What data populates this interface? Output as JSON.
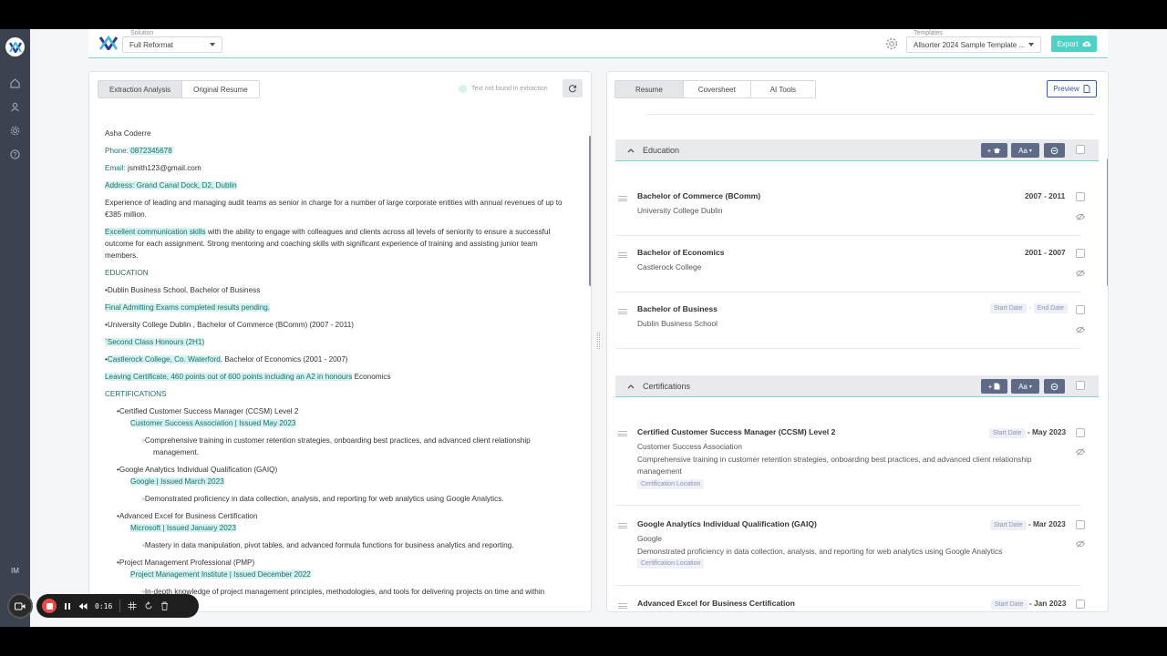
{
  "sidebar": {
    "user_initials": "IM"
  },
  "header": {
    "solution_label": "Solution",
    "solution_value": "Full Reformat",
    "templates_label": "Templates",
    "templates_value": "Allsorter 2024 Sample Template ...",
    "export_label": "Export"
  },
  "left_panel": {
    "tabs": [
      "Extraction Analysis",
      "Original Resume"
    ],
    "legend_text": "Text not found in extraction",
    "resume_lines": [
      {
        "segments": [
          {
            "t": "Asha Coderre",
            "h": 0
          }
        ]
      },
      {
        "segments": [
          {
            "t": "Phone:",
            "h": 2
          },
          {
            "t": " 0872345678",
            "h": 1
          }
        ]
      },
      {
        "segments": [
          {
            "t": "Email:",
            "h": 2
          },
          {
            "t": " jsmith123@gmail.com",
            "h": 0
          }
        ]
      },
      {
        "segments": [
          {
            "t": "Address: Grand Canal Dock, D2, Dublin",
            "h": 1
          }
        ]
      },
      {
        "segments": [
          {
            "t": "Experience of leading and managing audit teams as senior in charge for a number of large corporate entities with annual revenues of up to",
            "h": 0
          }
        ]
      },
      {
        "segments": [
          {
            "t": "€385 million.",
            "h": 0
          }
        ]
      },
      {
        "segments": [
          {
            "t": "Excellent communication skills",
            "h": 1
          },
          {
            "t": " with the ability to engage with colleagues and clients across all levels of seniority to ensure a successful",
            "h": 0
          }
        ]
      },
      {
        "segments": [
          {
            "t": "outcome for each assignment. Strong mentoring and coaching skills with significant experience of training and assisting junior team",
            "h": 0
          }
        ]
      },
      {
        "segments": [
          {
            "t": "members.",
            "h": 0
          }
        ]
      },
      {
        "segments": [
          {
            "t": "EDUCATION",
            "h": 2
          }
        ]
      },
      {
        "segments": [
          {
            "t": "•Dublin Business School, Bachelor of Business",
            "h": 0
          }
        ]
      },
      {
        "segments": [
          {
            "t": "Final Admitting Exams completed results pending.",
            "h": 1
          }
        ]
      },
      {
        "segments": [
          {
            "t": "•University College Dublin , Bachelor of Commerce (BComm) (2007 - 2011)",
            "h": 0
          }
        ]
      },
      {
        "segments": [
          {
            "t": "`Second Class Honours (2H1)",
            "h": 1
          }
        ]
      },
      {
        "segments": [
          {
            "t": "•",
            "h": 0
          },
          {
            "t": "Castlerock College, Co. Waterford",
            "h": 1
          },
          {
            "t": ", Bachelor of Economics (2001 - 2007)",
            "h": 0
          }
        ]
      },
      {
        "segments": [
          {
            "t": "Leaving Certificate, 460 points out of 600 points including an A2 in honours",
            "h": 1
          },
          {
            "t": " Economics",
            "h": 0
          }
        ]
      },
      {
        "segments": [
          {
            "t": "CERTIFICATIONS",
            "h": 2
          }
        ]
      },
      {
        "segments": [
          {
            "t": "•Certified Customer Success Manager (CCSM) Level 2",
            "h": 0
          }
        ]
      },
      {
        "segments": [
          {
            "t": "Customer Success Association | Issued May 2023",
            "h": 1
          }
        ]
      },
      {
        "segments": [
          {
            "t": "◦Comprehensive training in customer retention strategies, onboarding best practices, and advanced client relationship",
            "h": 0
          }
        ]
      },
      {
        "segments": [
          {
            "t": "management.",
            "h": 0
          }
        ]
      },
      {
        "segments": [
          {
            "t": "•Google Analytics Individual Qualification (GAIQ)",
            "h": 0
          }
        ]
      },
      {
        "segments": [
          {
            "t": "Google | Issued March 2023",
            "h": 1
          }
        ]
      },
      {
        "segments": [
          {
            "t": "◦Demonstrated proficiency in data collection, analysis, and reporting for web analytics using Google Analytics.",
            "h": 0
          }
        ]
      },
      {
        "segments": [
          {
            "t": "•Advanced Excel for Business Certification",
            "h": 0
          }
        ]
      },
      {
        "segments": [
          {
            "t": "Microsoft | Issued January 2023",
            "h": 1
          }
        ]
      },
      {
        "segments": [
          {
            "t": "◦Mastery in data manipulation, pivot tables, and advanced formula functions for business analytics and reporting.",
            "h": 0
          }
        ]
      },
      {
        "segments": [
          {
            "t": "•Project Management Professional (PMP)",
            "h": 0
          }
        ]
      },
      {
        "segments": [
          {
            "t": "Project Management Institute | Issued December 2022",
            "h": 1
          }
        ]
      },
      {
        "segments": [
          {
            "t": "◦In-depth knowledge of project management principles, methodologies, and tools for delivering projects on time and within",
            "h": 0
          }
        ]
      }
    ]
  },
  "right_panel": {
    "tabs": [
      "Resume",
      "Coversheet",
      "AI Tools"
    ],
    "preview_label": "Preview",
    "font_btn_label": "Aa",
    "education": {
      "title": "Education",
      "entries": [
        {
          "title": "Bachelor of Commerce (BComm)",
          "subtitle": "University College Dublin",
          "date": "2007 - 2011"
        },
        {
          "title": "Bachelor of Economics",
          "subtitle": "Castlerock College",
          "date": "2001 - 2007"
        },
        {
          "title": "Bachelor of Business",
          "subtitle": "Dublin Business School",
          "start_placeholder": "Start Date",
          "end_placeholder": "End Date"
        }
      ]
    },
    "certifications": {
      "title": "Certifications",
      "entries": [
        {
          "title": "Certified Customer Success Manager (CCSM) Level 2",
          "issuer": "Customer Success Association",
          "description": "Comprehensive training in customer retention strategies, onboarding best practices, and advanced client relationship management",
          "start_placeholder": "Start Date",
          "date": "- May 2023",
          "location_placeholder": "Certification Location"
        },
        {
          "title": "Google Analytics Individual Qualification (GAIQ)",
          "issuer": "Google",
          "description": "Demonstrated proficiency in data collection, analysis, and reporting for web analytics using Google Analytics",
          "start_placeholder": "Start Date",
          "date": "- Mar 2023",
          "location_placeholder": "Certification Location"
        },
        {
          "title": "Advanced Excel for Business Certification",
          "start_placeholder": "Start Date",
          "date": "- Jan 2023"
        }
      ]
    }
  },
  "recorder": {
    "time": "0:16"
  },
  "colors": {
    "accent": "#4fd1c5",
    "highlight": "#d4f3f0",
    "sidebar": "#3c4250",
    "section_button": "#5f6b86"
  }
}
